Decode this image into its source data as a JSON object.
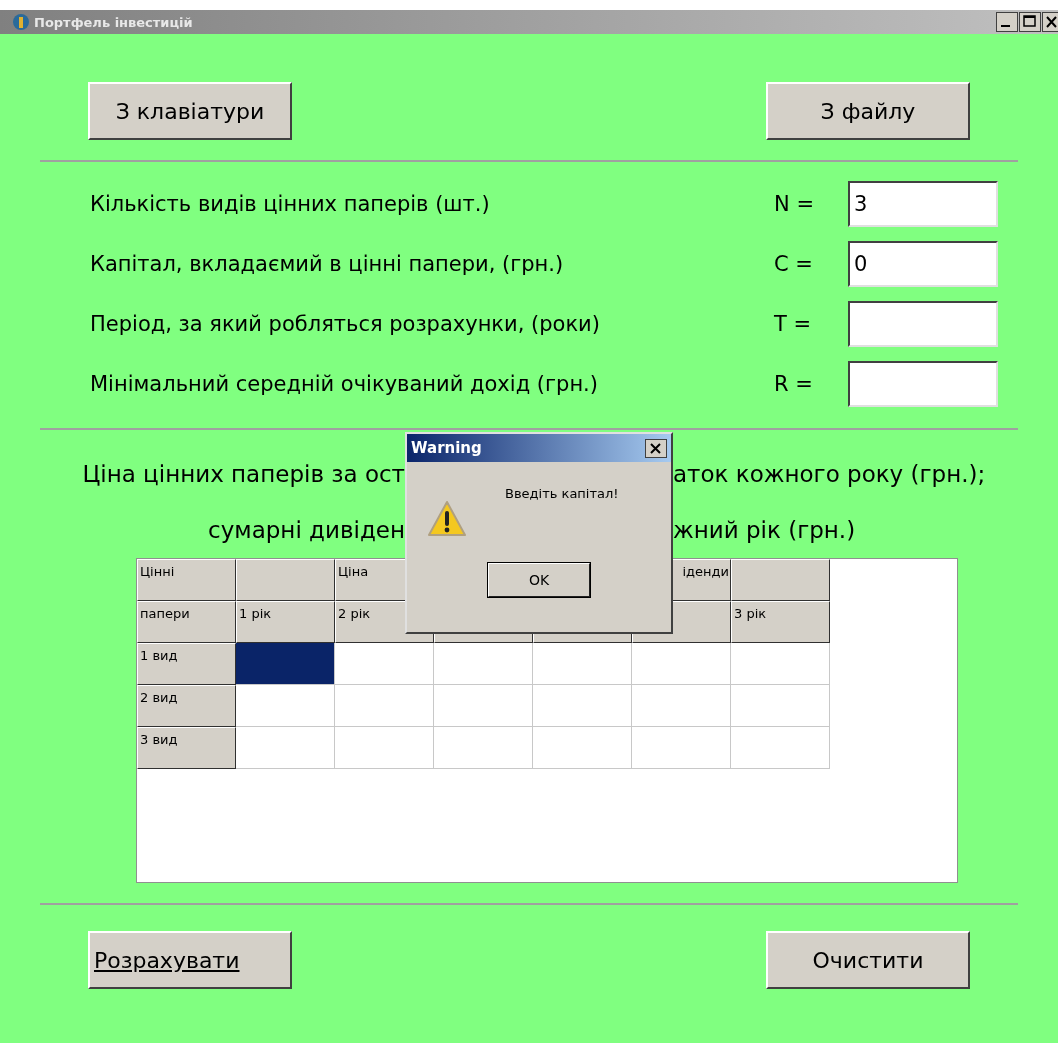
{
  "window": {
    "title": "Портфель інвестицій"
  },
  "source_buttons": [
    "З клавіатури",
    "З файлу"
  ],
  "fields": [
    {
      "label": "Кількість видів  цінних паперів (шт.)",
      "symbol": "N =",
      "value": "3"
    },
    {
      "label": "Капітал, вкладаємий в цінні папери, (грн.)",
      "symbol": "C =",
      "value": "0"
    },
    {
      "label": "Період, за який робляться розрахунки, (роки)",
      "symbol": "T ="
    },
    {
      "label": "Мінімальний середній очікуваний дохід (грн.)",
      "symbol": "R ="
    }
  ],
  "heading": [
    {
      "left": "Ціна цінних паперів за ост",
      "right": "аток кожного року (грн.);"
    },
    {
      "left": "сумарні дивіден",
      "right": "жний рік (грн.)"
    }
  ],
  "table": {
    "columns": [
      {
        "top": "Цінні",
        "bottom": "папери"
      },
      {
        "bottom": "1 рік"
      },
      {
        "top": "Ціна",
        "bottom": "2 рік"
      },
      {},
      {},
      {
        "top": "іденди"
      },
      {
        "bottom": "3 рік"
      }
    ],
    "rows": [
      {
        "label": "1 вид",
        "cells": [
          {
            "selected": true
          },
          {
            "selected": false
          },
          {
            "selected": false
          },
          {
            "selected": false
          },
          {
            "selected": false
          },
          {
            "selected": false
          }
        ]
      },
      {
        "label": "2 вид",
        "cells": [
          {
            "selected": false
          },
          {
            "selected": false
          },
          {
            "selected": false
          },
          {
            "selected": false
          },
          {
            "selected": false
          },
          {
            "selected": false
          }
        ]
      },
      {
        "label": "3 вид",
        "cells": [
          {
            "selected": false
          },
          {
            "selected": false
          },
          {
            "selected": false
          },
          {
            "selected": false
          },
          {
            "selected": false
          },
          {
            "selected": false
          }
        ]
      }
    ]
  },
  "action_buttons": [
    {
      "label": "Розрахувати",
      "underlined": true
    },
    {
      "label": "Очистити",
      "underlined": false
    }
  ],
  "dialog": {
    "title": "Warning",
    "message": "Введіть капітал!",
    "button": "OK"
  }
}
